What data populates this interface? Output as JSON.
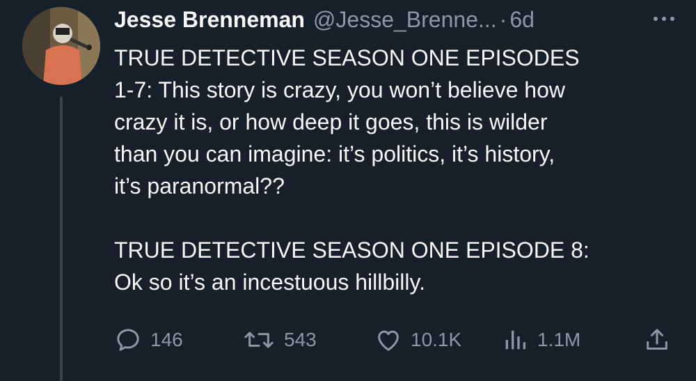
{
  "tweet": {
    "author_name": "Jesse Brenneman",
    "handle": "@Jesse_Brenne...",
    "separator": "·",
    "time": "6d",
    "body": "TRUE DETECTIVE SEASON ONE EPISODES\n1-7: This story is crazy, you won’t believe how\ncrazy it is, or how deep it goes, this is wilder\nthan you can imagine: it’s politics, it’s history,\nit’s paranormal??\n\nTRUE DETECTIVE SEASON ONE EPISODE 8:\nOk so it’s an incestuous hillbilly."
  },
  "actions": {
    "replies": "146",
    "retweets": "543",
    "likes": "10.1K",
    "views": "1.1M"
  },
  "icons": {
    "reply": "reply-bubble-icon",
    "retweet": "retweet-icon",
    "like": "heart-icon",
    "views": "views-bars-icon",
    "share": "share-upload-icon",
    "more": "more-dots-icon"
  },
  "colors": {
    "background": "#15202b",
    "text": "#f7f9f9",
    "muted": "#8b98a5",
    "thread_line": "#38444d"
  }
}
